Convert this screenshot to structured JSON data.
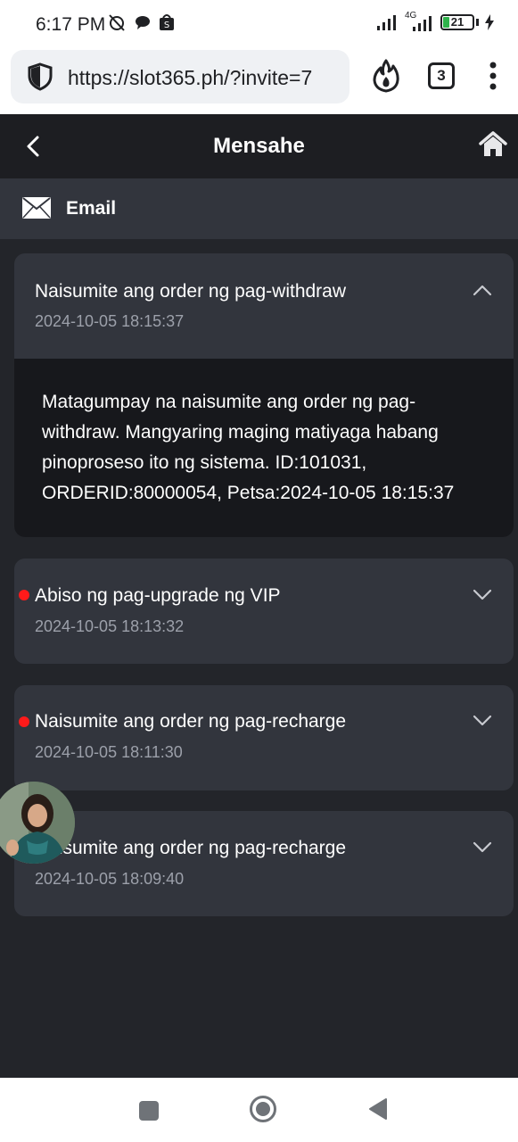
{
  "status_bar": {
    "time": "6:17 PM",
    "network": "4G",
    "battery": "21"
  },
  "browser": {
    "url": "https://slot365.ph/?invite=7",
    "tab_count": "3"
  },
  "header": {
    "title": "Mensahe"
  },
  "tab": {
    "label": "Email"
  },
  "messages": [
    {
      "title": "Naisumite ang order ng pag-withdraw",
      "date": "2024-10-05 18:15:37",
      "expanded": true,
      "unread": false,
      "body": "Matagumpay na naisumite ang order ng pag-withdraw. Mangyaring maging matiyaga habang pinoproseso ito ng sistema. ID:101031, ORDERID:80000054, Petsa:2024-10-05 18:15:37"
    },
    {
      "title": "Abiso ng pag-upgrade ng VIP",
      "date": "2024-10-05 18:13:32",
      "expanded": false,
      "unread": true
    },
    {
      "title": "Naisumite ang order ng pag-recharge",
      "date": "2024-10-05 18:11:30",
      "expanded": false,
      "unread": true
    },
    {
      "title": "Naisumite ang order ng pag-recharge",
      "date": "2024-10-05 18:09:40",
      "expanded": false,
      "unread": false
    }
  ],
  "colors": {
    "background": "#23252a",
    "card": "#32353d",
    "header": "#1d1e22",
    "unread": "#ff1a1a"
  }
}
